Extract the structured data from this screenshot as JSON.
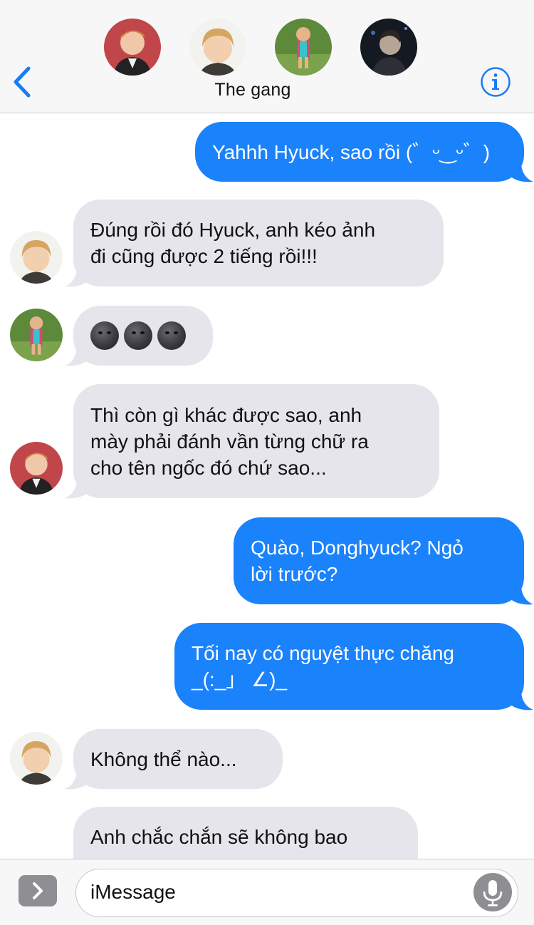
{
  "header": {
    "group_title": "The gang",
    "avatars": [
      "avatar-member-1",
      "avatar-member-2",
      "avatar-member-3",
      "avatar-member-4"
    ],
    "back_icon": "chevron-left-icon",
    "info_icon": "info-icon"
  },
  "messages": [
    {
      "side": "sent",
      "lines": [
        "Yahhh Hyuck, sao rồi (゛ᵕ‿ᵕ゛)"
      ]
    },
    {
      "side": "received",
      "lines": [
        "Đúng rồi đó Hyuck, anh kéo ảnh",
        "đi cũng được 2 tiếng rồi!!!"
      ]
    },
    {
      "side": "received",
      "lines": [
        "🌑🌑🌑"
      ]
    },
    {
      "side": "received",
      "lines": [
        "Thì còn gì khác được sao, anh",
        "mày phải đánh vần từng chữ ra",
        "cho tên ngốc đó chứ sao..."
      ]
    },
    {
      "side": "sent",
      "lines": [
        "Quào, Donghyuck? Ngỏ",
        "lời trước?"
      ]
    },
    {
      "side": "sent",
      "lines": [
        "Tối nay có nguyệt thực chăng",
        "_(:_」 ∠)_"
      ]
    },
    {
      "side": "received",
      "lines": [
        "Không thể nào..."
      ]
    },
    {
      "side": "received",
      "lines": [
        "Anh chắc chắn sẽ không bao"
      ]
    }
  ],
  "input": {
    "placeholder": "iMessage",
    "expand_icon": "chevron-right-icon",
    "mic_icon": "microphone-icon"
  },
  "colors": {
    "sent_bubble": "#1a82fb",
    "received_bubble": "#e6e5eb",
    "accent": "#1a7bf6"
  }
}
